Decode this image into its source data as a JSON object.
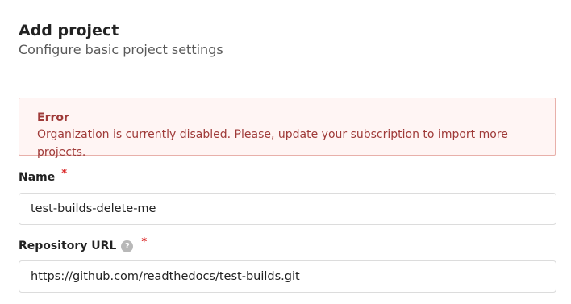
{
  "header": {
    "title": "Add project",
    "subtitle": "Configure basic project settings"
  },
  "error": {
    "title": "Error",
    "message": "Organization is currently disabled. Please, update your subscription to import more projects."
  },
  "form": {
    "name": {
      "label": "Name",
      "required_mark": "*",
      "value": "test-builds-delete-me"
    },
    "repository_url": {
      "label": "Repository URL",
      "help_icon": "?",
      "required_mark": "*",
      "value": "https://github.com/readthedocs/test-builds.git"
    }
  },
  "colors": {
    "error_text": "#9f3a38",
    "error_bg": "#fff5f4",
    "error_border": "#e8b0aa",
    "required": "#db2828"
  }
}
